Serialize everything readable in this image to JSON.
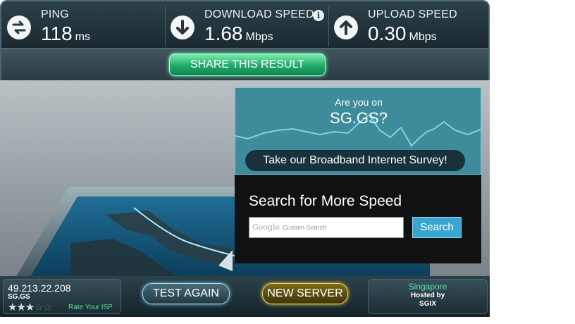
{
  "stats": {
    "ping": {
      "label": "PING",
      "value": "118",
      "unit": "ms",
      "icon": "swap-arrows-icon"
    },
    "download": {
      "label": "DOWNLOAD SPEED",
      "value": "1.68",
      "unit": "Mbps",
      "icon": "download-arrow-icon",
      "info": "i"
    },
    "upload": {
      "label": "UPLOAD SPEED",
      "value": "0.30",
      "unit": "Mbps",
      "icon": "upload-arrow-icon"
    }
  },
  "share_label": "SHARE THIS RESULT",
  "ad": {
    "question": "Are you on",
    "isp": "SG.GS?",
    "survey_label": "Take our Broadband Internet Survey!",
    "search_heading": "Search for More Speed",
    "search_placeholder": "Custom Search",
    "google_logo": "Google",
    "search_button": "Search"
  },
  "client": {
    "ip": "49.213.22.208",
    "isp": "SG.GS",
    "rating": 3,
    "rating_max": 5,
    "rate_label": "Rate Your ISP"
  },
  "buttons": {
    "test_again": "TEST AGAIN",
    "new_server": "NEW SERVER"
  },
  "server": {
    "city": "Singapore",
    "hosted_by": "Hosted by",
    "host": "SGIX"
  },
  "colors": {
    "accent_green": "#53e19a",
    "panel_dark": "#1b2a30",
    "ad_teal": "#3e8b9c",
    "button_blue": "#3aa6cf"
  }
}
